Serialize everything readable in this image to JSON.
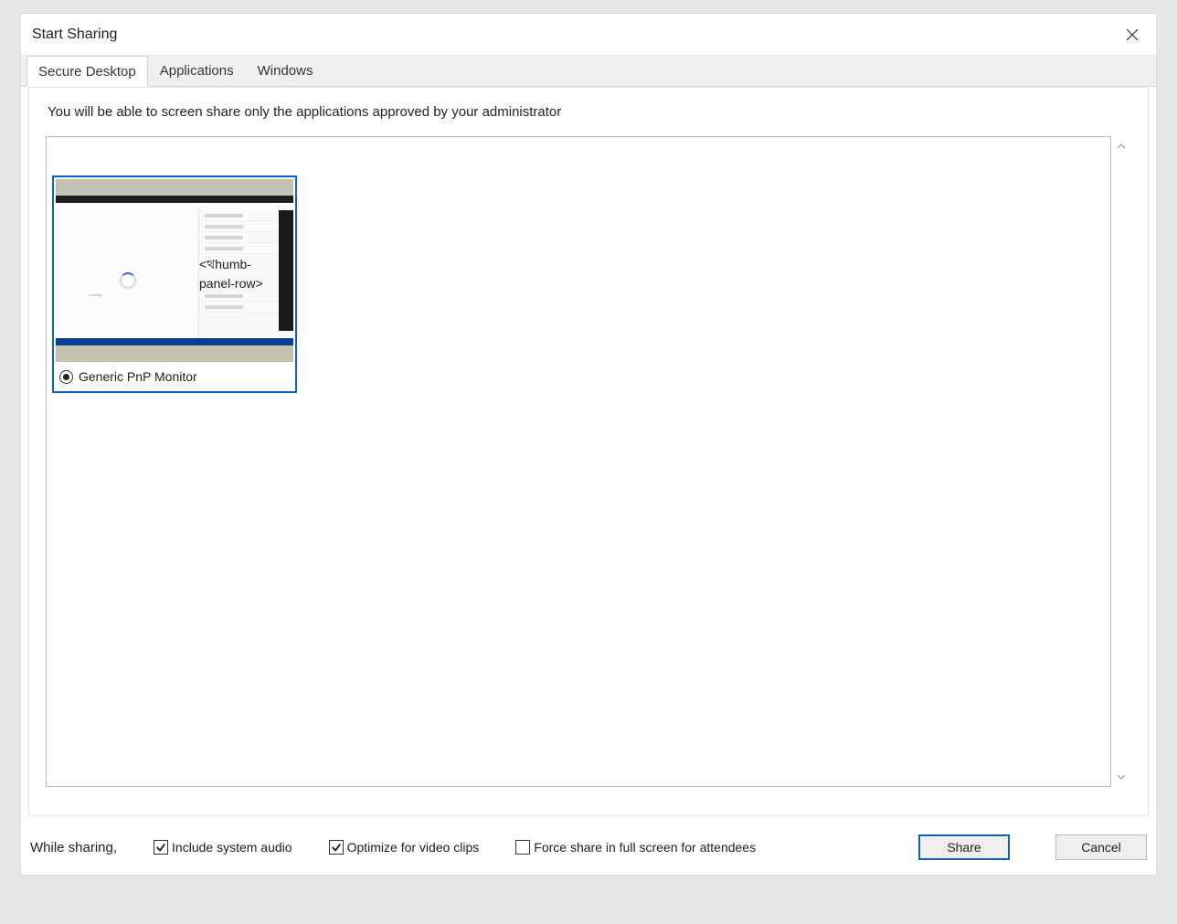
{
  "dialog_title": "Start Sharing",
  "tabs": [
    {
      "label": "Secure Desktop",
      "active": true
    },
    {
      "label": "Applications",
      "active": false
    },
    {
      "label": "Windows",
      "active": false
    }
  ],
  "info_text": "You will be able to screen share only the applications approved by your administrator",
  "monitors": [
    {
      "label": "Generic PnP Monitor",
      "selected": true
    }
  ],
  "bottom": {
    "while_sharing_label": "While sharing,",
    "include_audio": {
      "label": "Include system audio",
      "checked": true
    },
    "optimize_video": {
      "label": "Optimize for video clips",
      "checked": true
    },
    "force_fullscreen": {
      "label": "Force share in full screen for attendees",
      "checked": false
    },
    "share_label": "Share",
    "cancel_label": "Cancel"
  }
}
